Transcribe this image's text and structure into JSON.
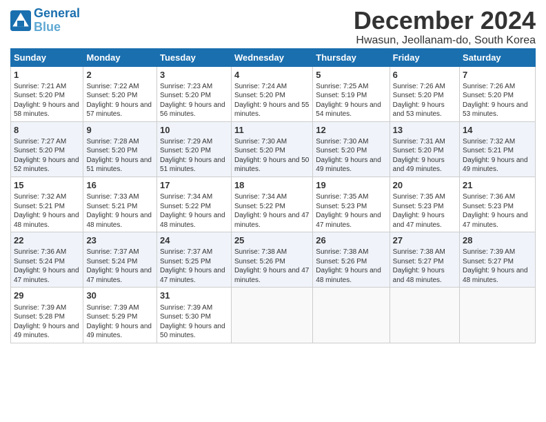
{
  "logo": {
    "line1": "General",
    "line2": "Blue"
  },
  "title": "December 2024",
  "subtitle": "Hwasun, Jeollanam-do, South Korea",
  "headers": [
    "Sunday",
    "Monday",
    "Tuesday",
    "Wednesday",
    "Thursday",
    "Friday",
    "Saturday"
  ],
  "weeks": [
    [
      {
        "day": "1",
        "rise": "7:21 AM",
        "set": "5:20 PM",
        "daylight": "9 hours and 58 minutes."
      },
      {
        "day": "2",
        "rise": "7:22 AM",
        "set": "5:20 PM",
        "daylight": "9 hours and 57 minutes."
      },
      {
        "day": "3",
        "rise": "7:23 AM",
        "set": "5:20 PM",
        "daylight": "9 hours and 56 minutes."
      },
      {
        "day": "4",
        "rise": "7:24 AM",
        "set": "5:20 PM",
        "daylight": "9 hours and 55 minutes."
      },
      {
        "day": "5",
        "rise": "7:25 AM",
        "set": "5:19 PM",
        "daylight": "9 hours and 54 minutes."
      },
      {
        "day": "6",
        "rise": "7:26 AM",
        "set": "5:20 PM",
        "daylight": "9 hours and 53 minutes."
      },
      {
        "day": "7",
        "rise": "7:26 AM",
        "set": "5:20 PM",
        "daylight": "9 hours and 53 minutes."
      }
    ],
    [
      {
        "day": "8",
        "rise": "7:27 AM",
        "set": "5:20 PM",
        "daylight": "9 hours and 52 minutes."
      },
      {
        "day": "9",
        "rise": "7:28 AM",
        "set": "5:20 PM",
        "daylight": "9 hours and 51 minutes."
      },
      {
        "day": "10",
        "rise": "7:29 AM",
        "set": "5:20 PM",
        "daylight": "9 hours and 51 minutes."
      },
      {
        "day": "11",
        "rise": "7:30 AM",
        "set": "5:20 PM",
        "daylight": "9 hours and 50 minutes."
      },
      {
        "day": "12",
        "rise": "7:30 AM",
        "set": "5:20 PM",
        "daylight": "9 hours and 49 minutes."
      },
      {
        "day": "13",
        "rise": "7:31 AM",
        "set": "5:20 PM",
        "daylight": "9 hours and 49 minutes."
      },
      {
        "day": "14",
        "rise": "7:32 AM",
        "set": "5:21 PM",
        "daylight": "9 hours and 49 minutes."
      }
    ],
    [
      {
        "day": "15",
        "rise": "7:32 AM",
        "set": "5:21 PM",
        "daylight": "9 hours and 48 minutes."
      },
      {
        "day": "16",
        "rise": "7:33 AM",
        "set": "5:21 PM",
        "daylight": "9 hours and 48 minutes."
      },
      {
        "day": "17",
        "rise": "7:34 AM",
        "set": "5:22 PM",
        "daylight": "9 hours and 48 minutes."
      },
      {
        "day": "18",
        "rise": "7:34 AM",
        "set": "5:22 PM",
        "daylight": "9 hours and 47 minutes."
      },
      {
        "day": "19",
        "rise": "7:35 AM",
        "set": "5:23 PM",
        "daylight": "9 hours and 47 minutes."
      },
      {
        "day": "20",
        "rise": "7:35 AM",
        "set": "5:23 PM",
        "daylight": "9 hours and 47 minutes."
      },
      {
        "day": "21",
        "rise": "7:36 AM",
        "set": "5:23 PM",
        "daylight": "9 hours and 47 minutes."
      }
    ],
    [
      {
        "day": "22",
        "rise": "7:36 AM",
        "set": "5:24 PM",
        "daylight": "9 hours and 47 minutes."
      },
      {
        "day": "23",
        "rise": "7:37 AM",
        "set": "5:24 PM",
        "daylight": "9 hours and 47 minutes."
      },
      {
        "day": "24",
        "rise": "7:37 AM",
        "set": "5:25 PM",
        "daylight": "9 hours and 47 minutes."
      },
      {
        "day": "25",
        "rise": "7:38 AM",
        "set": "5:26 PM",
        "daylight": "9 hours and 47 minutes."
      },
      {
        "day": "26",
        "rise": "7:38 AM",
        "set": "5:26 PM",
        "daylight": "9 hours and 48 minutes."
      },
      {
        "day": "27",
        "rise": "7:38 AM",
        "set": "5:27 PM",
        "daylight": "9 hours and 48 minutes."
      },
      {
        "day": "28",
        "rise": "7:39 AM",
        "set": "5:27 PM",
        "daylight": "9 hours and 48 minutes."
      }
    ],
    [
      {
        "day": "29",
        "rise": "7:39 AM",
        "set": "5:28 PM",
        "daylight": "9 hours and 49 minutes."
      },
      {
        "day": "30",
        "rise": "7:39 AM",
        "set": "5:29 PM",
        "daylight": "9 hours and 49 minutes."
      },
      {
        "day": "31",
        "rise": "7:39 AM",
        "set": "5:30 PM",
        "daylight": "9 hours and 50 minutes."
      },
      null,
      null,
      null,
      null
    ]
  ]
}
